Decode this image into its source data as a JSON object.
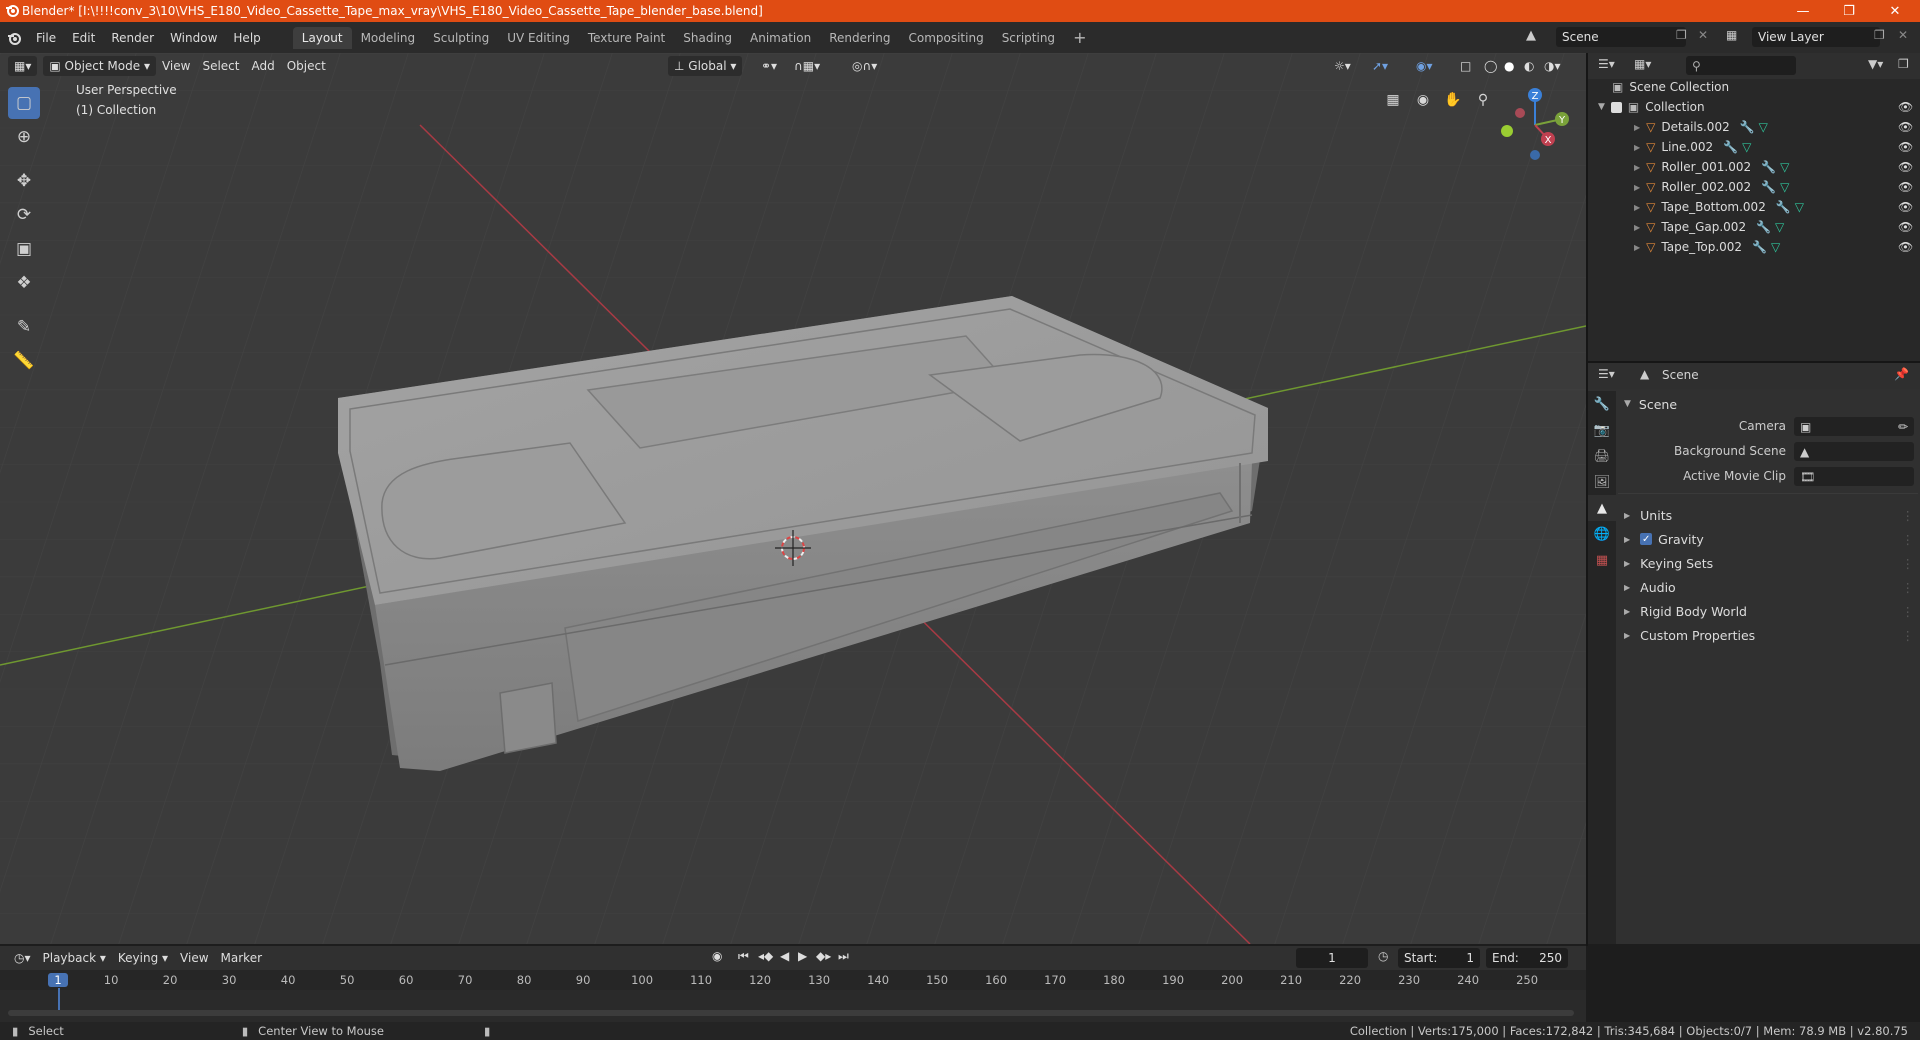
{
  "window": {
    "title": "Blender* [I:\\!!!!conv_3\\10\\VHS_E180_Video_Cassette_Tape_max_vray\\VHS_E180_Video_Cassette_Tape_blender_base.blend]"
  },
  "menu": {
    "items": [
      "File",
      "Edit",
      "Render",
      "Window",
      "Help"
    ],
    "workspaces": [
      "Layout",
      "Modeling",
      "Sculpting",
      "UV Editing",
      "Texture Paint",
      "Shading",
      "Animation",
      "Rendering",
      "Compositing",
      "Scripting"
    ],
    "active_workspace": "Layout",
    "scene": "Scene",
    "view_layer": "View Layer"
  },
  "viewport": {
    "mode": "Object Mode",
    "menus": [
      "View",
      "Select",
      "Add",
      "Object"
    ],
    "transform_orientation": "Global",
    "overlay_text_1": "User Perspective",
    "overlay_text_2": "(1) Collection",
    "gizmo_axes": [
      "Z",
      "Y",
      "X"
    ]
  },
  "outliner": {
    "root": "Scene Collection",
    "collection": "Collection",
    "objects": [
      "Details.002",
      "Line.002",
      "Roller_001.002",
      "Roller_002.002",
      "Tape_Bottom.002",
      "Tape_Gap.002",
      "Tape_Top.002"
    ]
  },
  "properties": {
    "context": "Scene",
    "panel_title": "Scene",
    "fields": [
      {
        "label": "Camera",
        "value": ""
      },
      {
        "label": "Background Scene",
        "value": ""
      },
      {
        "label": "Active Movie Clip",
        "value": ""
      }
    ],
    "sections": [
      "Units",
      "Gravity",
      "Keying Sets",
      "Audio",
      "Rigid Body World",
      "Custom Properties"
    ],
    "gravity_checked": true
  },
  "timeline": {
    "menus": [
      "Playback",
      "Keying",
      "View",
      "Marker"
    ],
    "current_frame": "1",
    "start_label": "Start:",
    "start": "1",
    "end_label": "End:",
    "end": "250",
    "ruler": [
      "1",
      "10",
      "20",
      "30",
      "40",
      "50",
      "60",
      "70",
      "80",
      "90",
      "100",
      "110",
      "120",
      "130",
      "140",
      "150",
      "160",
      "170",
      "180",
      "190",
      "200",
      "210",
      "220",
      "230",
      "240",
      "250"
    ]
  },
  "status": {
    "left": "Select",
    "middle": "Center View to Mouse",
    "right": "Collection | Verts:175,000 | Faces:172,842 | Tris:345,684 | Objects:0/7 | Mem: 78.9 MB | v2.80.75"
  },
  "colors": {
    "title_bar": "#e04c13",
    "accent": "#4772b3",
    "x_axis": "#c04050",
    "y_axis": "#7aa23a",
    "z_axis": "#3a80d8",
    "object_icon": "#e0883a",
    "mesh_icon": "#2fc39a"
  }
}
